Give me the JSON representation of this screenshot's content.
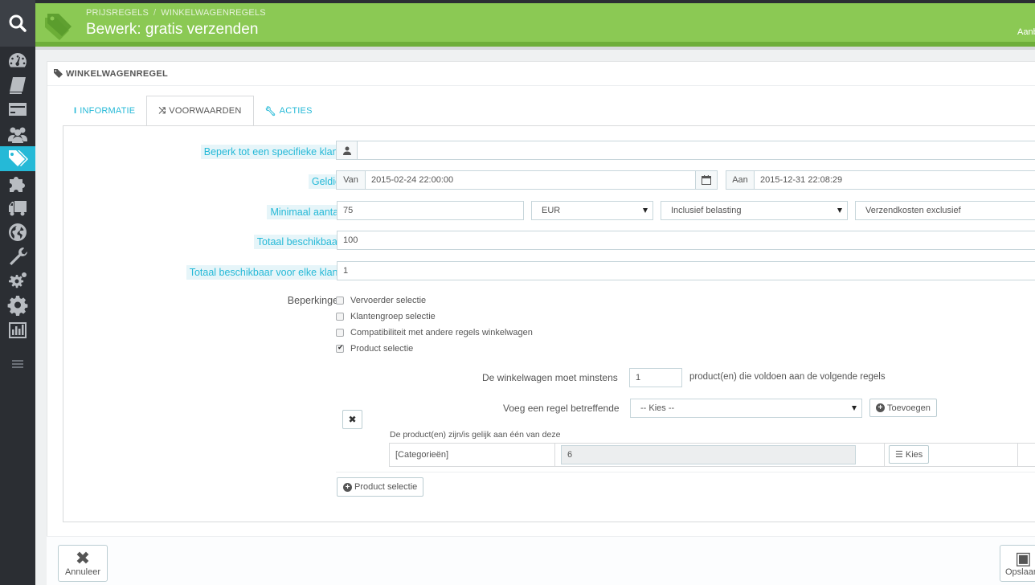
{
  "sidebar": {
    "items": [
      "dashboard-icon",
      "catalog-icon",
      "orders-icon",
      "customers-icon",
      "price-rules-icon",
      "modules-icon",
      "shipping-icon",
      "localization-icon",
      "preferences-icon",
      "advanced-icon",
      "administration-icon",
      "stats-icon"
    ]
  },
  "header": {
    "breadcrumb": [
      "PRIJSREGELS",
      "WINKELWAGENREGELS"
    ],
    "title": "Bewerk: gratis verzenden",
    "right_text": "Aanb"
  },
  "panel": {
    "heading": "WINKELWAGENREGEL",
    "tabs": [
      {
        "label": "INFORMATIE",
        "icon": "i"
      },
      {
        "label": "VOORWAARDEN",
        "icon": "shuffle"
      },
      {
        "label": "ACTIES",
        "icon": "wrench"
      }
    ]
  },
  "form": {
    "customer_label": "Beperk tot een specifieke klant",
    "customer_value": "",
    "valid_label": "Geldig",
    "from_label": "Van",
    "from_value": "2015-02-24 22:00:00",
    "to_label": "Aan",
    "to_value": "2015-12-31 22:08:29",
    "min_amount_label": "Minimaal aantal",
    "min_amount_value": "75",
    "currency": "EUR",
    "tax": "Inclusief belasting",
    "shipping": "Verzendkosten exclusief",
    "total_label": "Totaal beschikbaar",
    "total_value": "100",
    "per_customer_label": "Totaal beschikbaar voor elke klant",
    "per_customer_value": "1",
    "restrictions_label": "Beperkingen",
    "restrictions": [
      {
        "label": "Vervoerder selectie",
        "checked": false
      },
      {
        "label": "Klantengroep selectie",
        "checked": false
      },
      {
        "label": "Compatibiliteit met andere regels winkelwagen",
        "checked": false
      },
      {
        "label": "Product selectie",
        "checked": true
      }
    ],
    "min_products_prefix": "De winkelwagen moet minstens",
    "min_products_value": "1",
    "min_products_suffix": "product(en) die voldoen aan de volgende regels",
    "add_rule_label": "Voeg een regel betreffende",
    "add_rule_select": "-- Kies --",
    "add_button": "Toevoegen",
    "products_equal_label": "De product(en) zijn/is gelijk aan één van deze",
    "rule_type": "[Categorieën]",
    "rule_count": "6",
    "choose_button": "Kies",
    "product_selection_button": "Product selectie"
  },
  "footer": {
    "cancel": "Annuleer",
    "save": "Opslaan"
  }
}
